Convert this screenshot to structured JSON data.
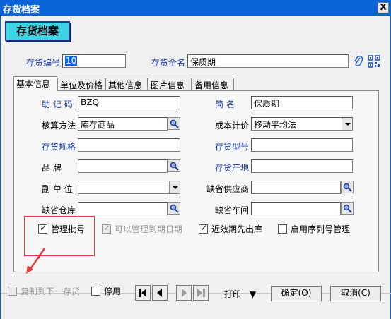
{
  "window": {
    "title": "存货档案",
    "close_label": "X"
  },
  "banner": "存货档案",
  "header": {
    "code_label": "存货编号",
    "code_value": "10",
    "name_label": "存货全名",
    "name_value": "保质期"
  },
  "tabs": [
    "基本信息",
    "单位及价格",
    "其他信息",
    "图片信息",
    "备用信息"
  ],
  "form": {
    "mnemonic_label": "助 记 码",
    "mnemonic_value": "BZQ",
    "short_label": "简    名",
    "short_value": "保质期",
    "accounting_label": "核算方法",
    "accounting_value": "库存商品",
    "costing_label": "成本计价",
    "costing_value": "移动平均法",
    "spec_label": "存货规格",
    "spec_value": "",
    "model_label": "存货型号",
    "model_value": "",
    "brand_label": "品    牌",
    "brand_value": "",
    "origin_label": "存货产地",
    "origin_value": "",
    "subunit_label": "副 单 位",
    "subunit_value": "",
    "supplier_label": "缺省供应商",
    "supplier_value": "",
    "warehouse_label": "缺省仓库",
    "warehouse_value": "",
    "workshop_label": "缺省车间",
    "workshop_value": ""
  },
  "options": {
    "batch": {
      "label": "管理批号",
      "checked": true
    },
    "expiry": {
      "label": "可以管理到期日期",
      "checked": true,
      "disabled": true
    },
    "fifo": {
      "label": "近效期先出库",
      "checked": true
    },
    "serial": {
      "label": "启用序列号管理",
      "checked": false
    }
  },
  "footer": {
    "copy_label": "复制到下一存货",
    "disable_label": "停用",
    "print_label": "打印",
    "ok_label": "确定(O)",
    "cancel_label": "取消(C)"
  },
  "colors": {
    "titlebar": "#0a64d8",
    "banner": "#3fd4e3",
    "label_blue": "#1f3da0",
    "annotation": "#e23b3b"
  }
}
